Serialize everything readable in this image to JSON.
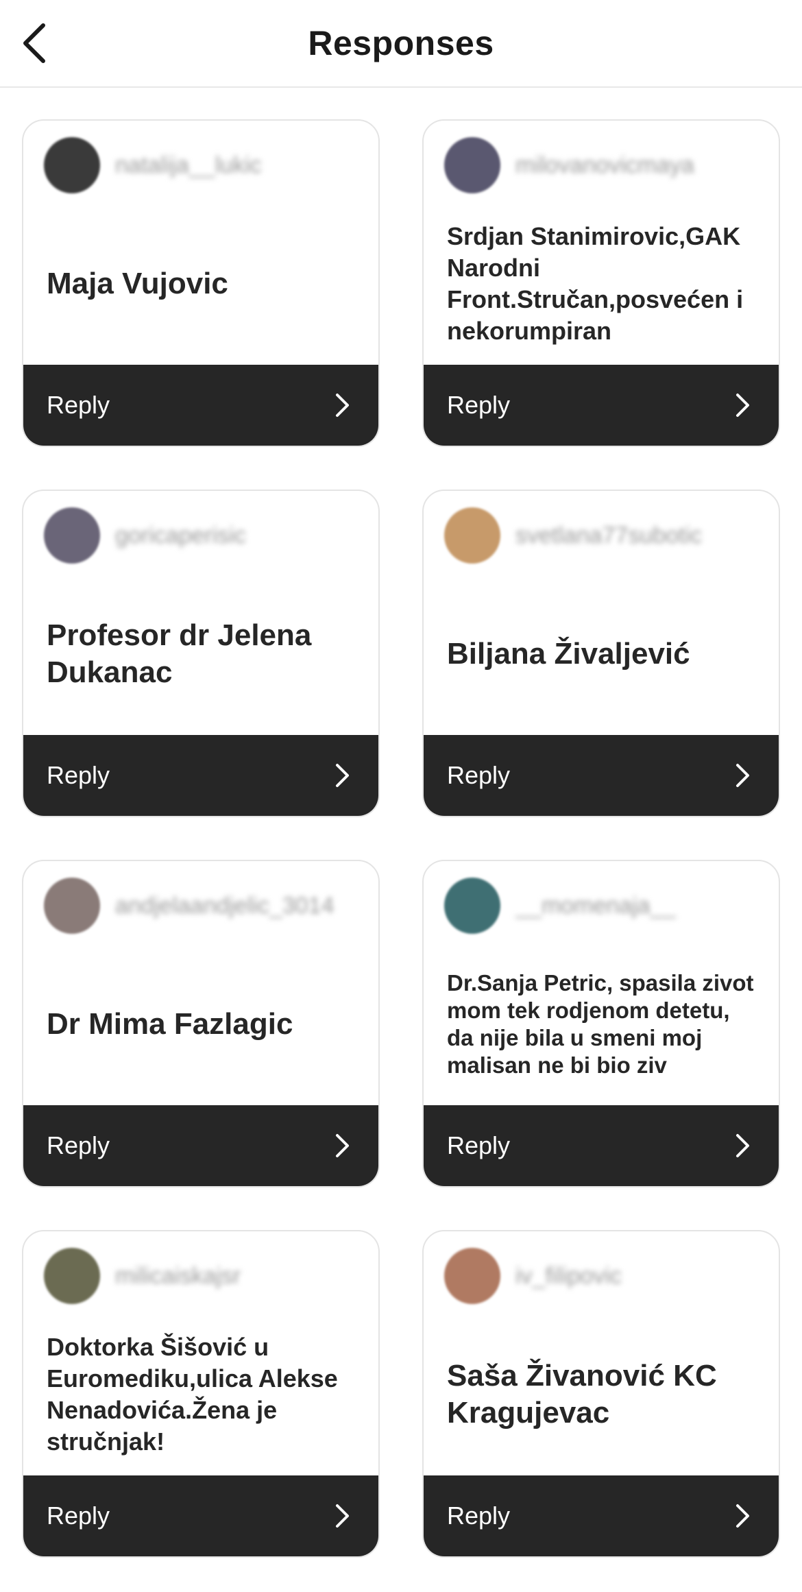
{
  "header": {
    "title": "Responses",
    "back_icon": "chevron-left-icon"
  },
  "colors": {
    "reply_bar": "#262626",
    "reply_text": "#ffffff",
    "card_border": "#e4e4e4",
    "username_text": "#9a9a9a"
  },
  "cards": [
    {
      "username": "natalija__lukic",
      "avatar_color": "#3a3a3a",
      "text": "Maja Vujovic",
      "text_size": "lg",
      "reply_label": "Reply"
    },
    {
      "username": "milovanovicmaya",
      "avatar_color": "#5a5870",
      "text": "Srdjan Stanimirovic,GAK Narodni Front.Stručan,posvećen i nekorumpiran",
      "text_size": "md",
      "reply_label": "Reply"
    },
    {
      "username": "goricaperisic",
      "avatar_color": "#6a6578",
      "text": "Profesor dr Jelena Dukanac",
      "text_size": "lg",
      "reply_label": "Reply"
    },
    {
      "username": "svetlana77subotic",
      "avatar_color": "#c79a6a",
      "text": "Biljana Živaljević",
      "text_size": "lg",
      "reply_label": "Reply"
    },
    {
      "username": "andjelaandjelic_3014",
      "avatar_color": "#8a7b78",
      "text": "Dr Mima Fazlagic",
      "text_size": "lg",
      "reply_label": "Reply"
    },
    {
      "username": "__momenaja__",
      "avatar_color": "#3f6f73",
      "text": "Dr.Sanja Petric, spasila zivot mom tek rodjenom detetu, da nije bila u smeni moj malisan ne bi bio ziv",
      "text_size": "sm",
      "reply_label": "Reply"
    },
    {
      "username": "milicaiskajsr",
      "avatar_color": "#6b6b52",
      "text": "Doktorka Šišović u Euromediku,ulica Alekse Nenadovića.Žena je stručnjak!",
      "text_size": "md",
      "reply_label": "Reply"
    },
    {
      "username": "iv_filipovic",
      "avatar_color": "#b07a62",
      "text": "Saša Živanović KC Kragujevac",
      "text_size": "lg",
      "reply_label": "Reply"
    }
  ]
}
